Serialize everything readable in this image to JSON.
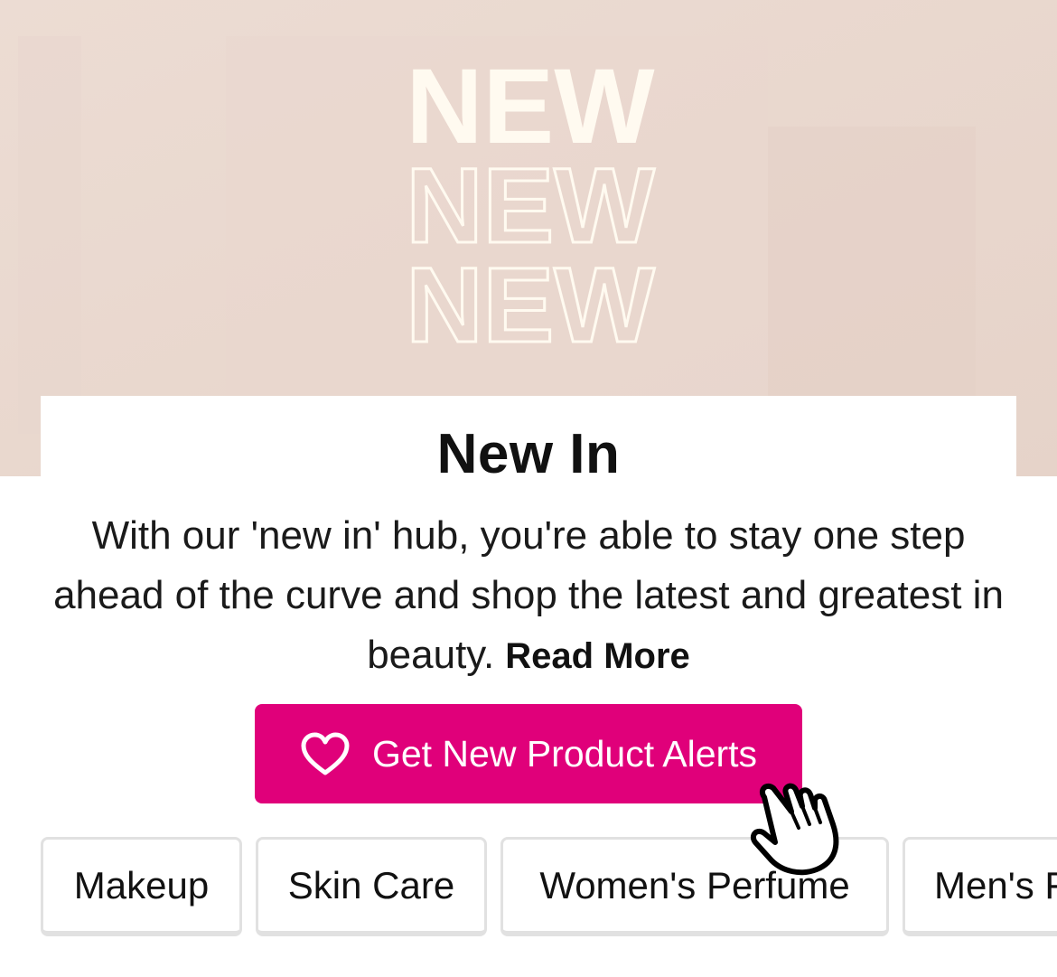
{
  "hero": {
    "words": [
      "NEW",
      "NEW",
      "NEW"
    ],
    "background_color": "#ead9d0",
    "text_color": "#fffaf0"
  },
  "header": {
    "title": "New In"
  },
  "intro": {
    "text": "With our 'new in' hub, you're able to stay one step ahead of the curve and shop the latest and greatest in beauty.",
    "read_more": "Read More"
  },
  "alerts_button": {
    "label": "Get New Product Alerts",
    "icon": "heart-icon",
    "color": "#e0007a"
  },
  "categories": [
    {
      "label": "Makeup"
    },
    {
      "label": "Skin Care"
    },
    {
      "label": "Women's Perfume"
    },
    {
      "label": "Men's Fragrance"
    }
  ]
}
